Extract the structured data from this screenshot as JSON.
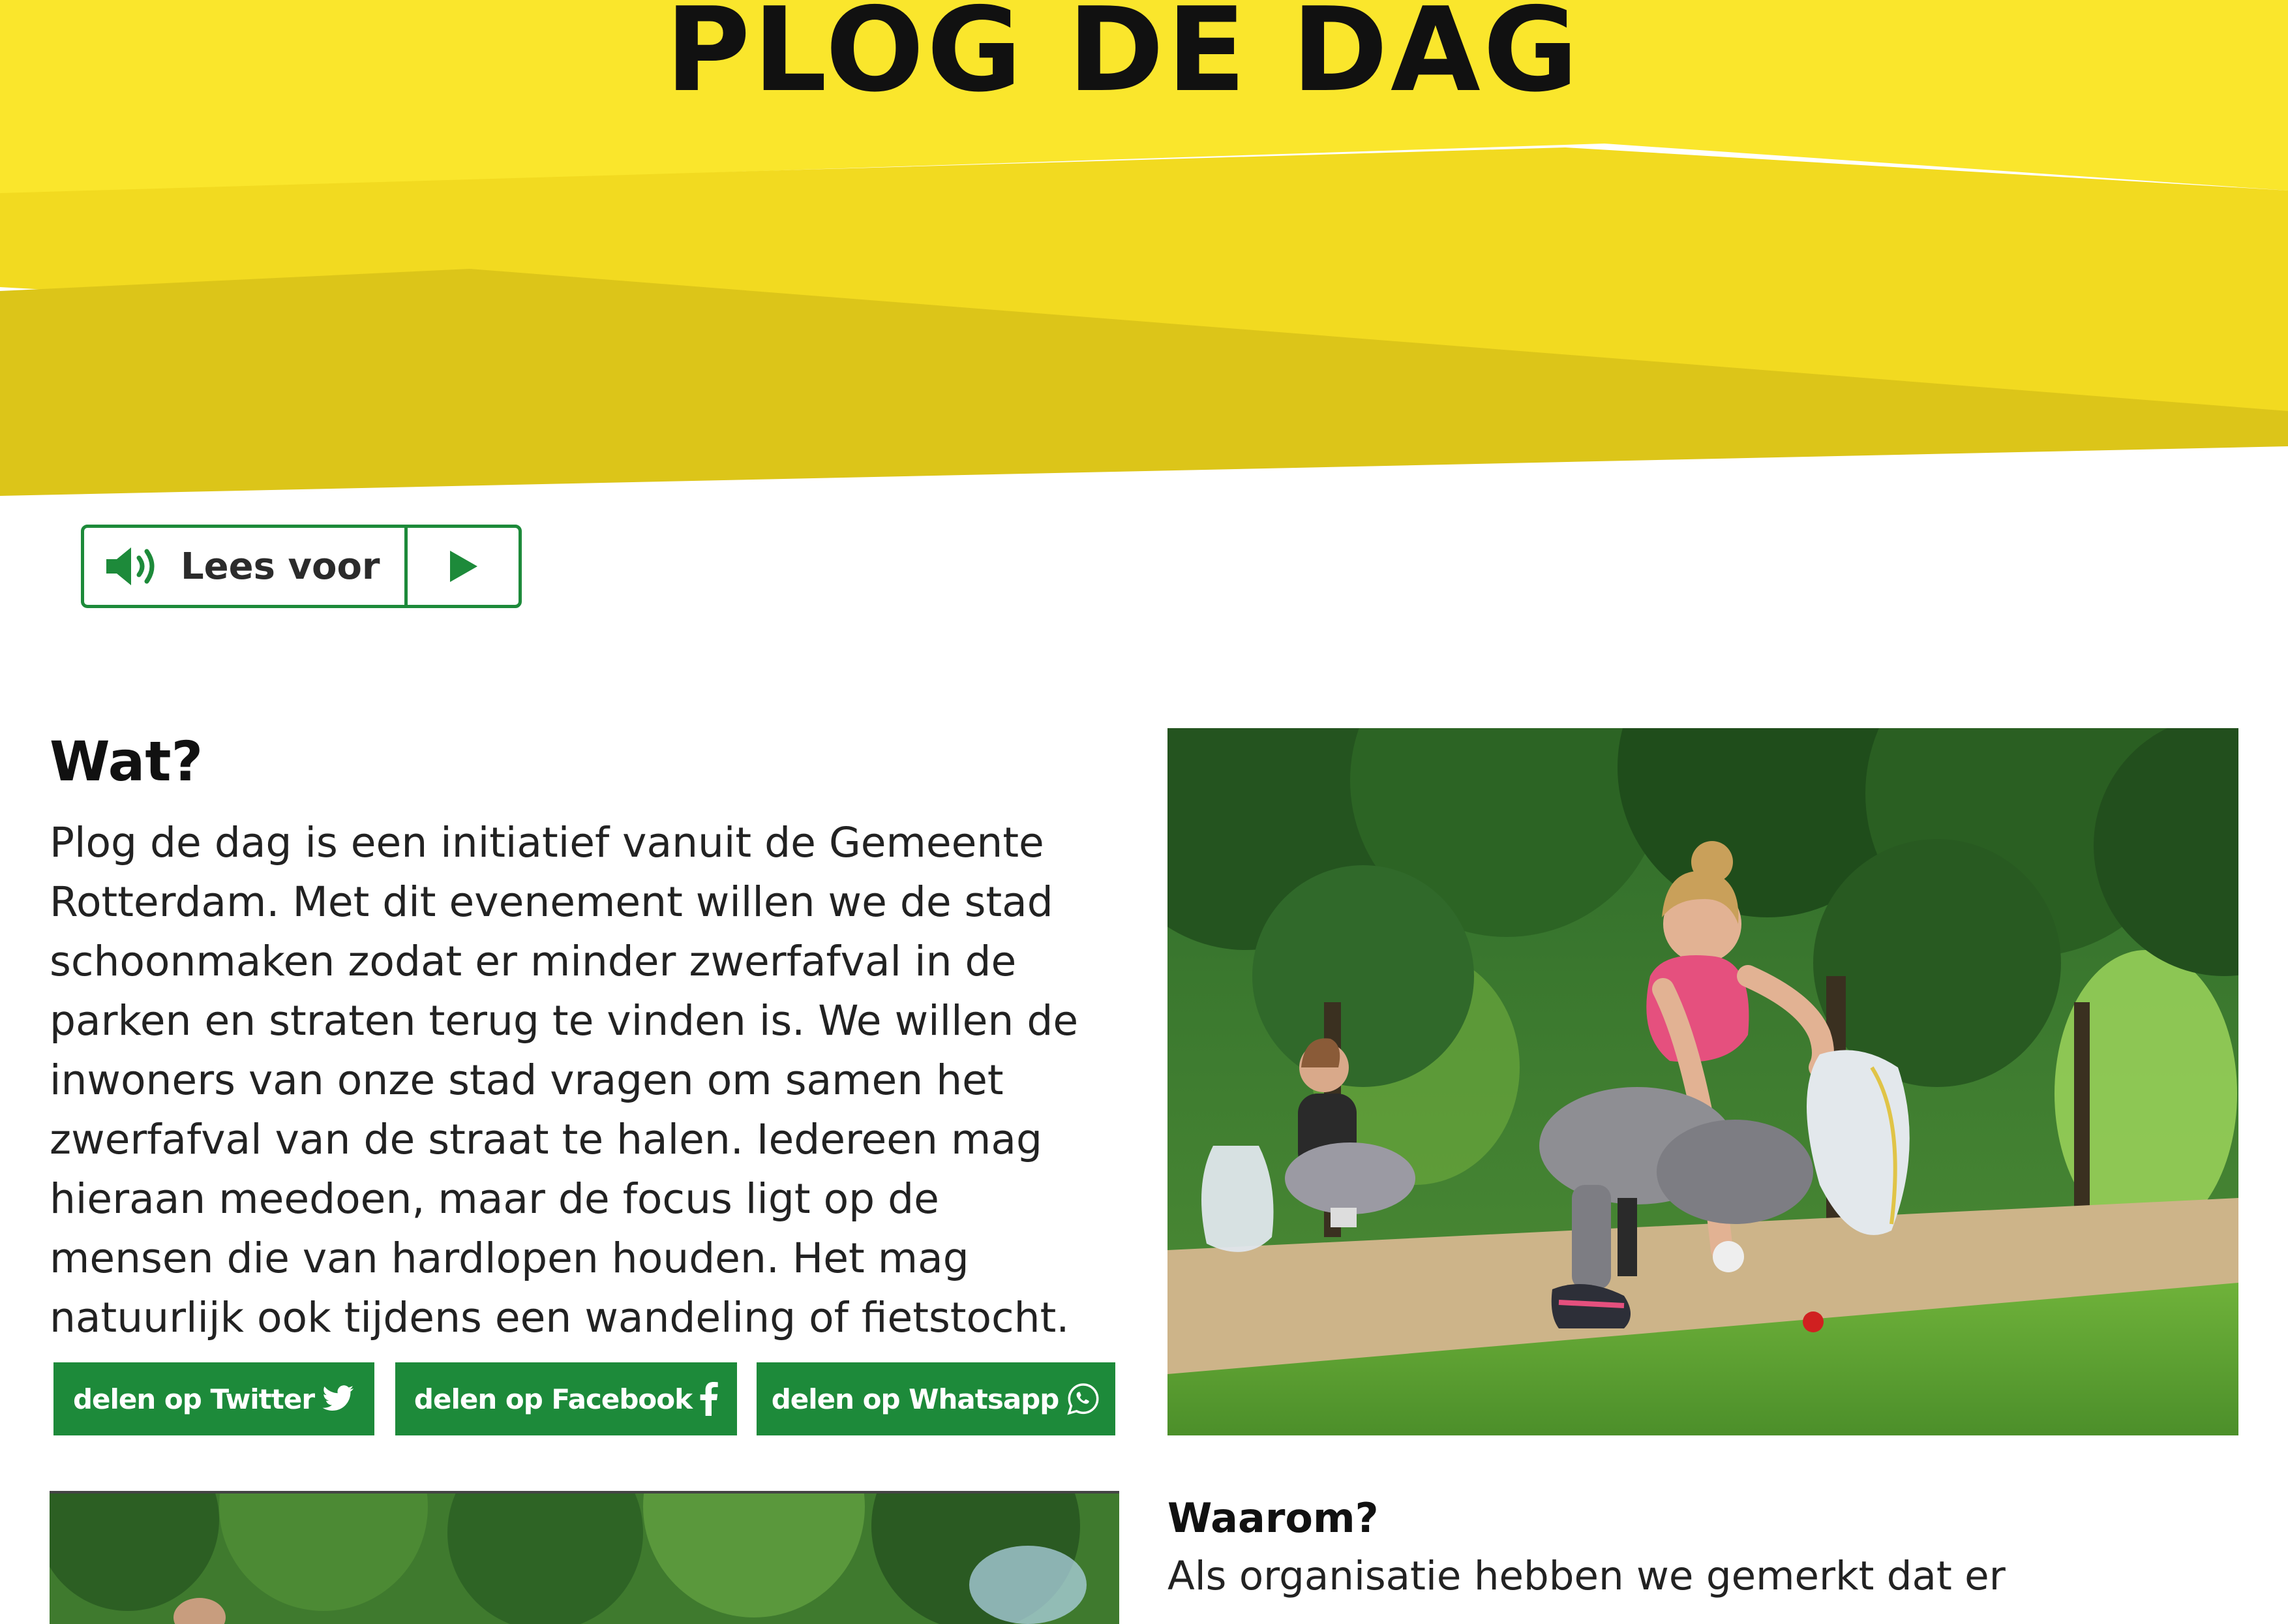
{
  "header": {
    "title": "PLOG DE DAG",
    "colors": {
      "yellow_light": "#fae62c",
      "yellow_mid": "#f2da20",
      "yellow_dark": "#dcc519"
    }
  },
  "read_aloud": {
    "label": "Lees voor",
    "speaker_icon": "speaker-icon",
    "play_icon": "play-icon",
    "color": "#1d8a3a"
  },
  "section_wat": {
    "heading": "Wat?",
    "lines": [
      "Plog de dag is een initiatief vanuit de Gemeente",
      "Rotterdam. Met dit evenement willen we de stad",
      "schoonmaken zodat er minder zwerfafval in de",
      "parken en straten terug te vinden is. We willen de",
      "inwoners van onze stad vragen om samen het",
      "zwerfafval van de straat te halen. Iedereen mag",
      "hieraan meedoen, maar de focus ligt op de",
      "mensen die van hardlopen houden. Het mag",
      "natuurlijk ook tijdens een wandeling of fietstocht."
    ]
  },
  "share": {
    "twitter": {
      "label": "delen op Twitter",
      "icon": "twitter-icon"
    },
    "facebook": {
      "label": "delen op Facebook",
      "icon": "facebook-icon"
    },
    "whatsapp": {
      "label": "delen op Whatsapp",
      "icon": "whatsapp-icon"
    },
    "color": "#1d8a3a"
  },
  "section_waarom": {
    "heading": "Waarom?",
    "first_line": "Als organisatie hebben we gemerkt dat er"
  }
}
